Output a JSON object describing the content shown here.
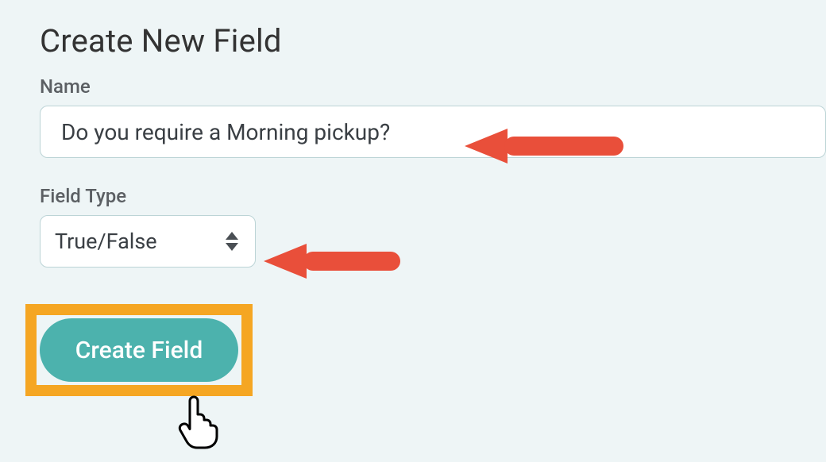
{
  "title": "Create New Field",
  "form": {
    "name_label": "Name",
    "name_value": "Do you require a Morning pickup?",
    "type_label": "Field Type",
    "type_value": "True/False",
    "submit_label": "Create Field"
  },
  "annotations": {
    "highlight_color": "#f5a623",
    "arrow_color": "#e94f3a"
  }
}
